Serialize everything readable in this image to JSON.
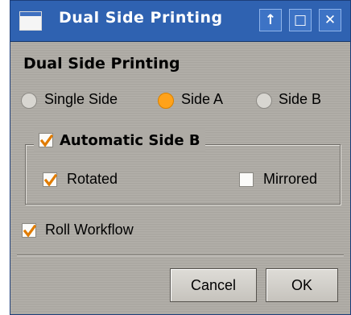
{
  "window": {
    "title": "Dual Side Printing"
  },
  "titlebar_buttons": {
    "up": "↑",
    "maximize": "□",
    "close": "✕"
  },
  "dialog": {
    "heading": "Dual Side Printing",
    "radios": [
      {
        "label": "Single Side",
        "selected": false
      },
      {
        "label": "Side A",
        "selected": true
      },
      {
        "label": "Side B",
        "selected": false
      }
    ],
    "automatic_side_b": {
      "label": "Automatic Side B",
      "checked": true,
      "rotated": {
        "label": "Rotated",
        "checked": true
      },
      "mirrored": {
        "label": "Mirrored",
        "checked": false
      }
    },
    "roll_workflow": {
      "label": "Roll Workflow",
      "checked": true
    },
    "buttons": {
      "cancel": "Cancel",
      "ok": "OK"
    }
  },
  "colors": {
    "titlebar": "#2f62b1",
    "radio_selected": "#ffa21a",
    "checkmark": "#e07b00"
  }
}
